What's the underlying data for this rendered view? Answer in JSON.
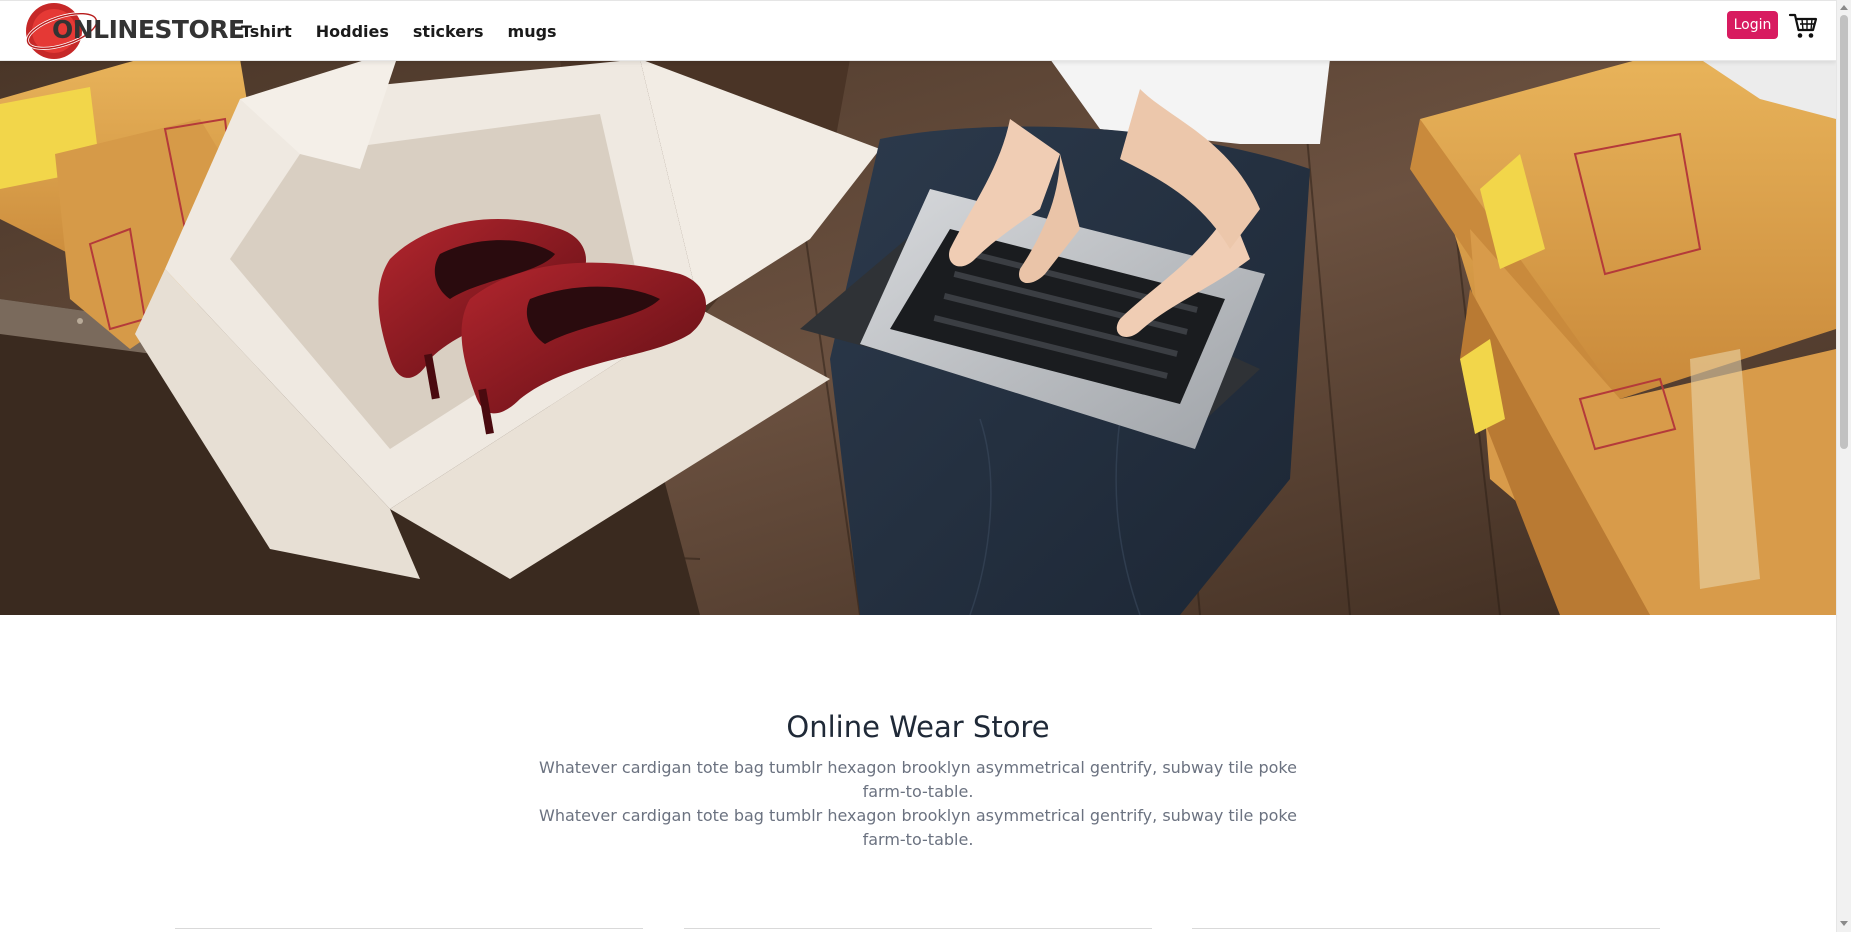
{
  "header": {
    "logo_text": "ONLINESTORE",
    "nav": [
      "Tshirt",
      "Hoddies",
      "stickers",
      "mugs"
    ],
    "login_label": "Login",
    "accent_color": "#d81b60",
    "cart_icon": "shopping-cart-icon"
  },
  "hero": {
    "image": "photo of a person typing on a laptop beside open cardboard boxes with red high heels"
  },
  "intro": {
    "title": "Online Wear Store",
    "paragraph_1": "Whatever cardigan tote bag tumblr hexagon brooklyn asymmetrical gentrify, subway tile poke farm-to-table.",
    "paragraph_2": "Whatever cardigan tote bag tumblr hexagon brooklyn asymmetrical gentrify, subway tile poke farm-to-table."
  }
}
